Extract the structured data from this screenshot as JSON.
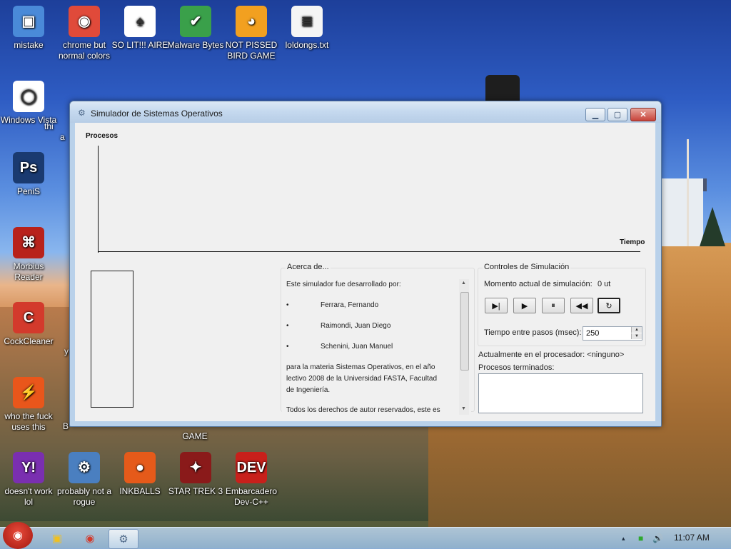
{
  "desktop": {
    "icons": [
      {
        "label": "mistake",
        "glyph": "▣",
        "color": "#4a8ad8"
      },
      {
        "label": "chrome but normal colors",
        "glyph": "◉",
        "color": "#e04a3a"
      },
      {
        "label": "SO LIT!!! AIRE",
        "glyph": "♠",
        "color": "#ffffff"
      },
      {
        "label": "Malware Bytes",
        "glyph": "✔",
        "color": "#3aa04a"
      },
      {
        "label": "NOT PISSED BIRD GAME",
        "glyph": "◕",
        "color": "#f2a020"
      },
      {
        "label": "loldongs.txt",
        "glyph": "≣",
        "color": "#f5f5f5"
      },
      {
        "label": "Windows Vista",
        "glyph": "◯",
        "color": "#ffffff"
      },
      {
        "label": "PeniS",
        "glyph": "Ps",
        "color": "#1a3a70"
      },
      {
        "label": "Morbius Reader",
        "glyph": "⌘",
        "color": "#b8221b"
      },
      {
        "label": "CockCleaner",
        "glyph": "C",
        "color": "#d33a2c"
      },
      {
        "label": "who the fuck uses this",
        "glyph": "⚡",
        "color": "#e9561b"
      },
      {
        "label": "doesn't work lol",
        "glyph": "Y!",
        "color": "#7a2fb0"
      },
      {
        "label": "probably not a rogue",
        "glyph": "⚙",
        "color": "#4a7fc0"
      },
      {
        "label": "INKBALLS",
        "glyph": "●",
        "color": "#e55a1a"
      },
      {
        "label": "STAR TREK 3",
        "glyph": "✦",
        "color": "#8a1a1a"
      },
      {
        "label": "Embarcadero Dev-C++",
        "glyph": "DEV",
        "color": "#c8201b"
      }
    ],
    "partial_labels": {
      "l1": "thi",
      "l2": "a",
      "l3": "y",
      "l4": "B",
      "l5": "GAME"
    }
  },
  "window": {
    "title": "Simulador de Sistemas Operativos",
    "buttons": {
      "min": "▁",
      "max": "▢",
      "close": "✕"
    },
    "chart": {
      "y_label": "Procesos",
      "x_label": "Tiempo"
    },
    "about": {
      "title": "Acerca de...",
      "intro": "Este simulador fue desarrollado por:",
      "authors": [
        "Ferrara, Fernando",
        "Raimondi, Juan Diego",
        "Schenini, Juan Manuel"
      ],
      "body": [
        "para la materia Sistemas Operativos, en el año",
        "lectivo 2008 de la Universidad FASTA, Facultad",
        "de Ingeniería."
      ],
      "footer": "Todos los derechos de autor reservados, este es"
    },
    "controls": {
      "title": "Controles de Simulación",
      "moment_label": "Momento actual de simulación:",
      "moment_value": "0 ut",
      "buttons": {
        "step": "▶|",
        "play": "▶",
        "pause": "⏸",
        "rewind": "◀◀",
        "reset": "↻"
      },
      "delay_label": "Tiempo entre pasos (msec):",
      "delay_value": "250"
    },
    "cpu_label": "Actualmente en el procesador: <ninguno>",
    "done_label": "Procesos terminados:"
  },
  "taskbar": {
    "start_glyph": "◉",
    "items": [
      {
        "glyph": "▣"
      },
      {
        "glyph": "◉"
      },
      {
        "glyph": "⚙"
      }
    ],
    "tray": {
      "up": "▴",
      "net": "■",
      "vol": "🔊"
    },
    "clock": "11:07 AM"
  }
}
